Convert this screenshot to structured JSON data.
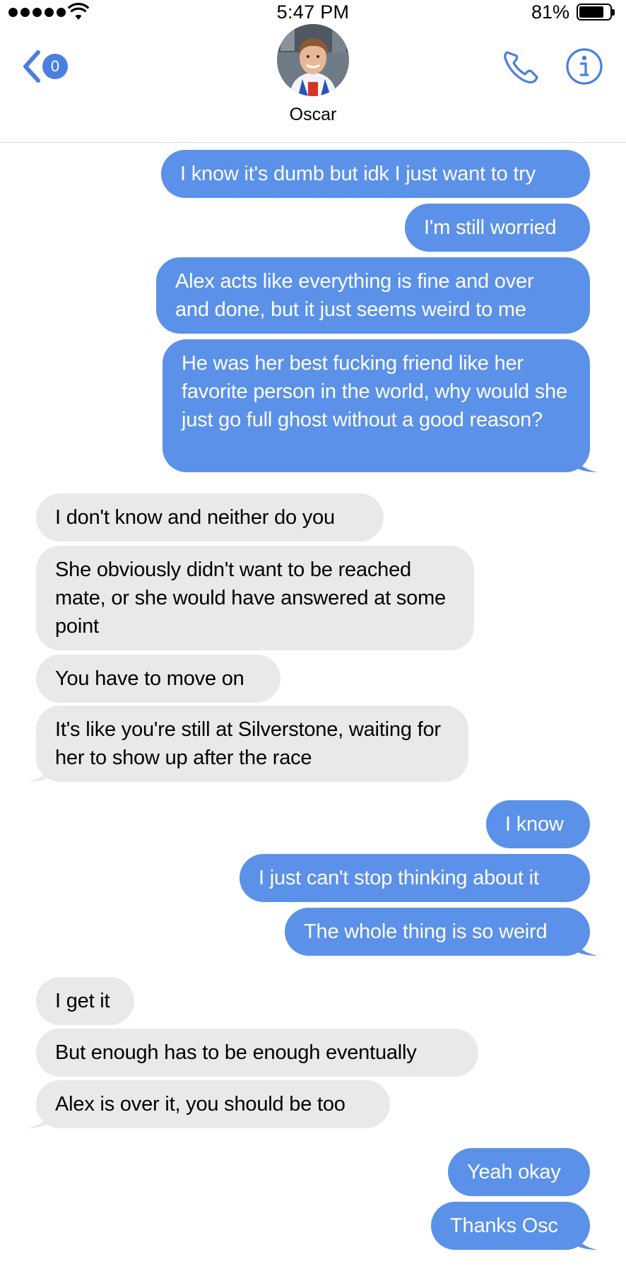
{
  "status_bar": {
    "time": "5:47 PM",
    "battery": "81%",
    "battery_level": 0.81,
    "signal_bars": 5
  },
  "header": {
    "back_badge": "0",
    "contact_name": "Oscar"
  },
  "colors": {
    "accent": "#4a7fe0",
    "outgoing_bubble": "#5b91e8",
    "incoming_bubble": "#e9e9eb"
  },
  "messages": [
    {
      "direction": "out",
      "text": "I know it's dumb but idk I just want to try"
    },
    {
      "direction": "out",
      "text": "I'm still worried"
    },
    {
      "direction": "out",
      "text": "Alex acts like everything is fine and over and done, but it just seems weird to me"
    },
    {
      "direction": "out",
      "text": "He was her best fucking friend like her favorite person in the world, why would she just go full ghost without a good reason?"
    },
    {
      "direction": "in",
      "text": "I don't know and neither do you"
    },
    {
      "direction": "in",
      "text": "She obviously didn't want to be reached mate, or she would have answered at some point"
    },
    {
      "direction": "in",
      "text": "You have to move on"
    },
    {
      "direction": "in",
      "text": "It's like you're still at Silverstone, waiting for her to show up after the race"
    },
    {
      "direction": "out",
      "text": "I know"
    },
    {
      "direction": "out",
      "text": "I just can't stop thinking about it"
    },
    {
      "direction": "out",
      "text": "The whole thing is so weird"
    },
    {
      "direction": "in",
      "text": "I get it"
    },
    {
      "direction": "in",
      "text": "But enough has to be enough eventually"
    },
    {
      "direction": "in",
      "text": "Alex is over it, you should be too"
    },
    {
      "direction": "out",
      "text": "Yeah okay"
    },
    {
      "direction": "out",
      "text": "Thanks Osc"
    }
  ]
}
